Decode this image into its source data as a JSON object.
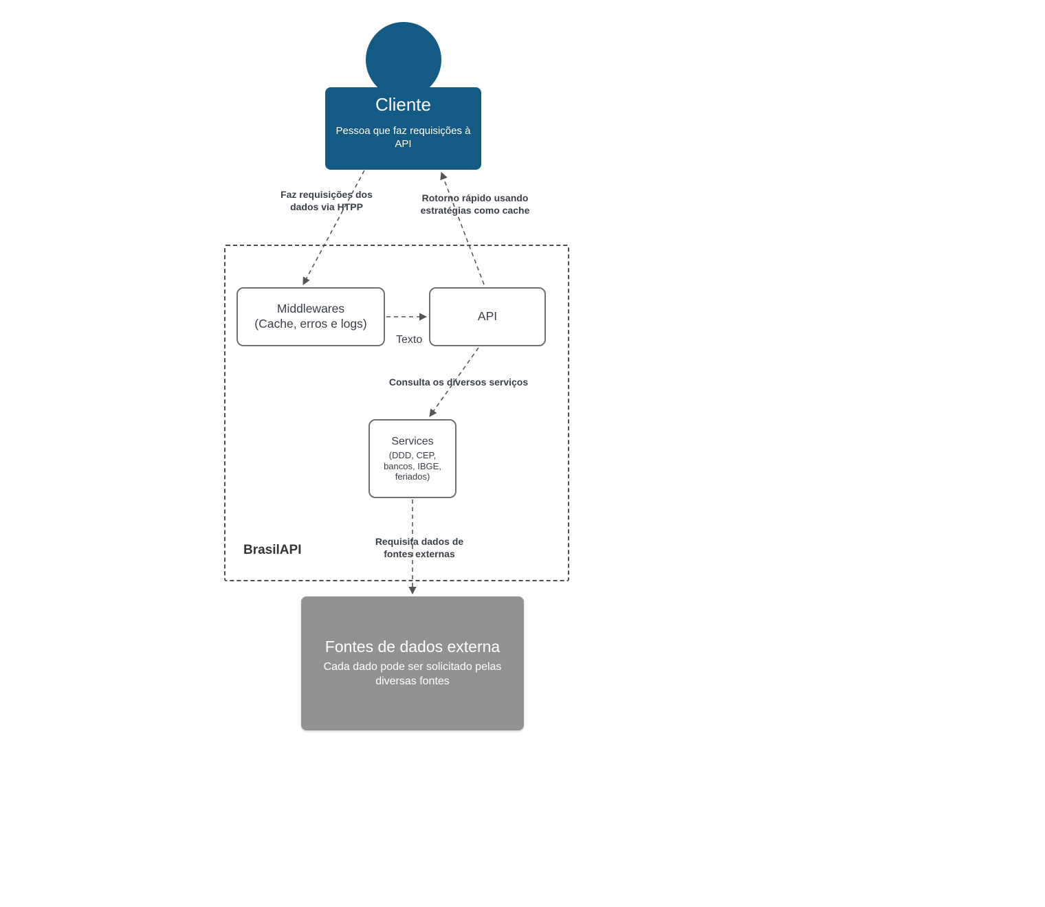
{
  "palette": {
    "actor": "#135a85",
    "boxBorder": "#707070",
    "dashed": "#4c4c4c",
    "ext": "#929292",
    "text": "#3a3e46"
  },
  "actor": {
    "title": "Cliente",
    "desc": "Pessoa que faz requisições à API"
  },
  "container": {
    "label": "BrasilAPI"
  },
  "boxes": {
    "middlewares": {
      "line1": "Middlewares",
      "line2": "(Cache, erros e logs)"
    },
    "api": {
      "line1": "API"
    },
    "services": {
      "line1": "Services",
      "line2": "(DDD, CEP, bancos, IBGE, feriados)"
    }
  },
  "external": {
    "title": "Fontes de dados externa",
    "desc": "Cada dado pode ser solicitado pelas diversas fontes"
  },
  "edges": {
    "client_to_mw": "Faz requisições dos dados via HTPP",
    "api_to_client": "Rotorno rápido usando estratégias como cache",
    "mw_to_api_sub": "Texto",
    "api_to_services": "Consulta os diversos serviços",
    "services_to_ext": "Requisita dados de fontes externas"
  }
}
